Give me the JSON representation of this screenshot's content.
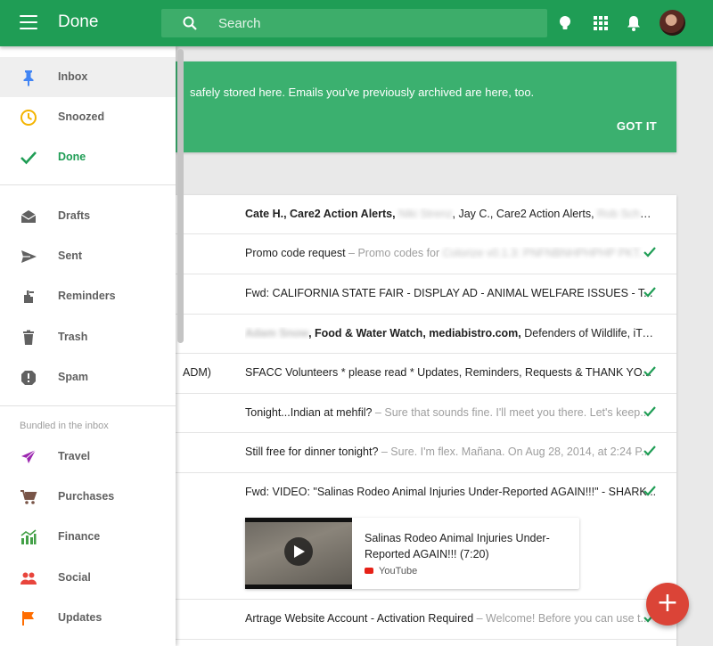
{
  "header": {
    "title": "Done",
    "search_placeholder": "Search"
  },
  "sidebar": {
    "items": [
      {
        "label": "Inbox",
        "icon": "pin-icon"
      },
      {
        "label": "Snoozed",
        "icon": "clock-icon"
      },
      {
        "label": "Done",
        "icon": "check-icon"
      },
      {
        "label": "Drafts",
        "icon": "drafts-icon"
      },
      {
        "label": "Sent",
        "icon": "send-icon"
      },
      {
        "label": "Reminders",
        "icon": "reminder-icon"
      },
      {
        "label": "Trash",
        "icon": "trash-icon"
      },
      {
        "label": "Spam",
        "icon": "spam-icon"
      }
    ],
    "bundles_label": "Bundled in the inbox",
    "bundles": [
      {
        "label": "Travel",
        "icon": "plane-icon"
      },
      {
        "label": "Purchases",
        "icon": "cart-icon"
      },
      {
        "label": "Finance",
        "icon": "finance-icon"
      },
      {
        "label": "Social",
        "icon": "people-icon"
      },
      {
        "label": "Updates",
        "icon": "flag-icon"
      }
    ]
  },
  "banner": {
    "text": "safely stored here. Emails you've previously archived are here, too.",
    "action": "GOT IT"
  },
  "emails": [
    {
      "senders_a": "Cate H., Care2 Action Alerts,",
      "blur_a": "Niki Strenz",
      "senders_b": ", Jay C., Care2 Action Alerts,",
      "blur_b": "Rob Schultz",
      "tail": "..."
    },
    {
      "subject": "Promo code request",
      "snippet": " – Promo codes for",
      "blur": "Colorize v0.1.3: PNFNBNHPHPHP PKT..."
    },
    {
      "subject": "Fwd: CALIFORNIA STATE FAIR - DISPLAY AD - ANIMAL WELFARE ISSUES - T..."
    },
    {
      "blur": "Adam Snow",
      "senders": ", Food & Water Watch, mediabistro.com,",
      "rest": " Defenders of Wildlife, iTune..."
    },
    {
      "left_stub": "ADM)",
      "subject": "SFACC Volunteers * please read * Updates, Reminders, Requests & THANK YO..."
    },
    {
      "subject": "Tonight...Indian at mehfil?",
      "snippet": " – Sure that sounds fine. I'll meet you there. Let's keep..."
    },
    {
      "subject": "Still free for dinner tonight?",
      "snippet": " – Sure. I'm flex. Mañana. On Aug 28, 2014, at 2:24 P..."
    },
    {
      "subject": "Fwd: VIDEO: \"Salinas Rodeo Animal Injuries Under-Reported AGAIN!!!\" - SHARK..."
    },
    {
      "subject": "Artrage Website Account - Activation Required",
      "snippet": " – Welcome! Before you can use t..."
    }
  ],
  "video": {
    "title": "Salinas Rodeo Animal Injuries Under-Reported AGAIN!!! (7:20)",
    "source": "YouTube"
  },
  "fab_label": "+",
  "colors": {
    "brand_green": "#1f9d55",
    "banner_green": "#3bb06f",
    "fab_red": "#db4437"
  }
}
